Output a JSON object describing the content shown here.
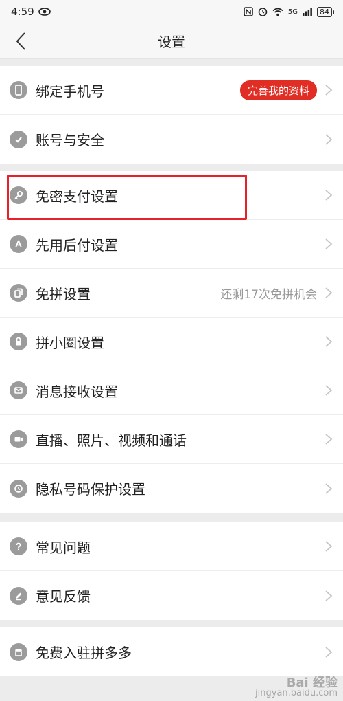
{
  "status_bar": {
    "time": "4:59",
    "network": "5G",
    "battery": "84"
  },
  "header": {
    "title": "设置"
  },
  "group1": [
    {
      "label": "绑定手机号",
      "badge": "完善我的资料",
      "icon": "phone-icon"
    },
    {
      "label": "账号与安全",
      "icon": "shield-check-icon"
    }
  ],
  "group2": [
    {
      "label": "免密支付设置",
      "icon": "key-icon"
    },
    {
      "label": "先用后付设置",
      "icon": "pay-later-icon"
    },
    {
      "label": "免拼设置",
      "extra": "还剩17次免拼机会",
      "icon": "cards-icon"
    },
    {
      "label": "拼小圈设置",
      "icon": "lock-icon"
    },
    {
      "label": "消息接收设置",
      "icon": "message-icon"
    },
    {
      "label": "直播、照片、视频和通话",
      "icon": "video-icon"
    },
    {
      "label": "隐私号码保护设置",
      "icon": "privacy-phone-icon"
    }
  ],
  "group3": [
    {
      "label": "常见问题",
      "icon": "question-icon"
    },
    {
      "label": "意见反馈",
      "icon": "pencil-icon"
    }
  ],
  "group4": [
    {
      "label": "免费入驻拼多多",
      "icon": "store-icon"
    }
  ],
  "watermark": {
    "main": "Bai 经验",
    "sub": "jingyan.baidu.com"
  },
  "colors": {
    "accent": "#e02e24",
    "highlight_box": "#e8202a",
    "icon_gray": "#9b9b9b"
  }
}
